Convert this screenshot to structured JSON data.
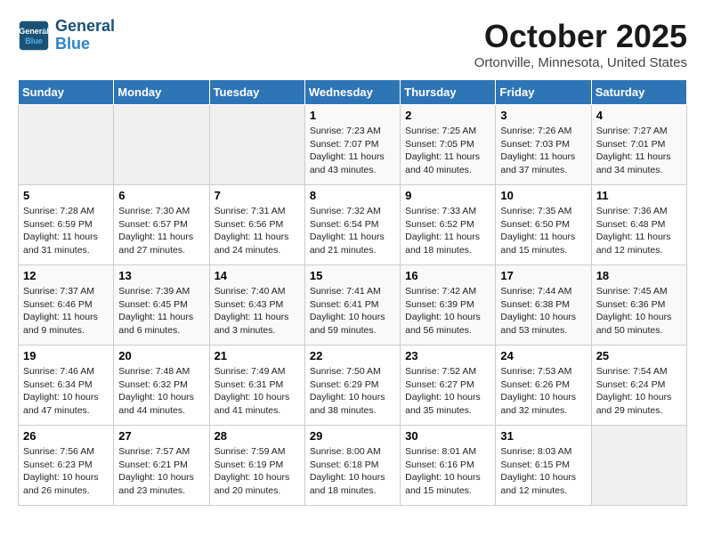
{
  "header": {
    "logo_line1": "General",
    "logo_line2": "Blue",
    "title": "October 2025",
    "subtitle": "Ortonville, Minnesota, United States"
  },
  "days_of_week": [
    "Sunday",
    "Monday",
    "Tuesday",
    "Wednesday",
    "Thursday",
    "Friday",
    "Saturday"
  ],
  "weeks": [
    {
      "days": [
        {
          "num": "",
          "info": ""
        },
        {
          "num": "",
          "info": ""
        },
        {
          "num": "",
          "info": ""
        },
        {
          "num": "1",
          "info": "Sunrise: 7:23 AM\nSunset: 7:07 PM\nDaylight: 11 hours\nand 43 minutes."
        },
        {
          "num": "2",
          "info": "Sunrise: 7:25 AM\nSunset: 7:05 PM\nDaylight: 11 hours\nand 40 minutes."
        },
        {
          "num": "3",
          "info": "Sunrise: 7:26 AM\nSunset: 7:03 PM\nDaylight: 11 hours\nand 37 minutes."
        },
        {
          "num": "4",
          "info": "Sunrise: 7:27 AM\nSunset: 7:01 PM\nDaylight: 11 hours\nand 34 minutes."
        }
      ]
    },
    {
      "days": [
        {
          "num": "5",
          "info": "Sunrise: 7:28 AM\nSunset: 6:59 PM\nDaylight: 11 hours\nand 31 minutes."
        },
        {
          "num": "6",
          "info": "Sunrise: 7:30 AM\nSunset: 6:57 PM\nDaylight: 11 hours\nand 27 minutes."
        },
        {
          "num": "7",
          "info": "Sunrise: 7:31 AM\nSunset: 6:56 PM\nDaylight: 11 hours\nand 24 minutes."
        },
        {
          "num": "8",
          "info": "Sunrise: 7:32 AM\nSunset: 6:54 PM\nDaylight: 11 hours\nand 21 minutes."
        },
        {
          "num": "9",
          "info": "Sunrise: 7:33 AM\nSunset: 6:52 PM\nDaylight: 11 hours\nand 18 minutes."
        },
        {
          "num": "10",
          "info": "Sunrise: 7:35 AM\nSunset: 6:50 PM\nDaylight: 11 hours\nand 15 minutes."
        },
        {
          "num": "11",
          "info": "Sunrise: 7:36 AM\nSunset: 6:48 PM\nDaylight: 11 hours\nand 12 minutes."
        }
      ]
    },
    {
      "days": [
        {
          "num": "12",
          "info": "Sunrise: 7:37 AM\nSunset: 6:46 PM\nDaylight: 11 hours\nand 9 minutes."
        },
        {
          "num": "13",
          "info": "Sunrise: 7:39 AM\nSunset: 6:45 PM\nDaylight: 11 hours\nand 6 minutes."
        },
        {
          "num": "14",
          "info": "Sunrise: 7:40 AM\nSunset: 6:43 PM\nDaylight: 11 hours\nand 3 minutes."
        },
        {
          "num": "15",
          "info": "Sunrise: 7:41 AM\nSunset: 6:41 PM\nDaylight: 10 hours\nand 59 minutes."
        },
        {
          "num": "16",
          "info": "Sunrise: 7:42 AM\nSunset: 6:39 PM\nDaylight: 10 hours\nand 56 minutes."
        },
        {
          "num": "17",
          "info": "Sunrise: 7:44 AM\nSunset: 6:38 PM\nDaylight: 10 hours\nand 53 minutes."
        },
        {
          "num": "18",
          "info": "Sunrise: 7:45 AM\nSunset: 6:36 PM\nDaylight: 10 hours\nand 50 minutes."
        }
      ]
    },
    {
      "days": [
        {
          "num": "19",
          "info": "Sunrise: 7:46 AM\nSunset: 6:34 PM\nDaylight: 10 hours\nand 47 minutes."
        },
        {
          "num": "20",
          "info": "Sunrise: 7:48 AM\nSunset: 6:32 PM\nDaylight: 10 hours\nand 44 minutes."
        },
        {
          "num": "21",
          "info": "Sunrise: 7:49 AM\nSunset: 6:31 PM\nDaylight: 10 hours\nand 41 minutes."
        },
        {
          "num": "22",
          "info": "Sunrise: 7:50 AM\nSunset: 6:29 PM\nDaylight: 10 hours\nand 38 minutes."
        },
        {
          "num": "23",
          "info": "Sunrise: 7:52 AM\nSunset: 6:27 PM\nDaylight: 10 hours\nand 35 minutes."
        },
        {
          "num": "24",
          "info": "Sunrise: 7:53 AM\nSunset: 6:26 PM\nDaylight: 10 hours\nand 32 minutes."
        },
        {
          "num": "25",
          "info": "Sunrise: 7:54 AM\nSunset: 6:24 PM\nDaylight: 10 hours\nand 29 minutes."
        }
      ]
    },
    {
      "days": [
        {
          "num": "26",
          "info": "Sunrise: 7:56 AM\nSunset: 6:23 PM\nDaylight: 10 hours\nand 26 minutes."
        },
        {
          "num": "27",
          "info": "Sunrise: 7:57 AM\nSunset: 6:21 PM\nDaylight: 10 hours\nand 23 minutes."
        },
        {
          "num": "28",
          "info": "Sunrise: 7:59 AM\nSunset: 6:19 PM\nDaylight: 10 hours\nand 20 minutes."
        },
        {
          "num": "29",
          "info": "Sunrise: 8:00 AM\nSunset: 6:18 PM\nDaylight: 10 hours\nand 18 minutes."
        },
        {
          "num": "30",
          "info": "Sunrise: 8:01 AM\nSunset: 6:16 PM\nDaylight: 10 hours\nand 15 minutes."
        },
        {
          "num": "31",
          "info": "Sunrise: 8:03 AM\nSunset: 6:15 PM\nDaylight: 10 hours\nand 12 minutes."
        },
        {
          "num": "",
          "info": ""
        }
      ]
    }
  ]
}
